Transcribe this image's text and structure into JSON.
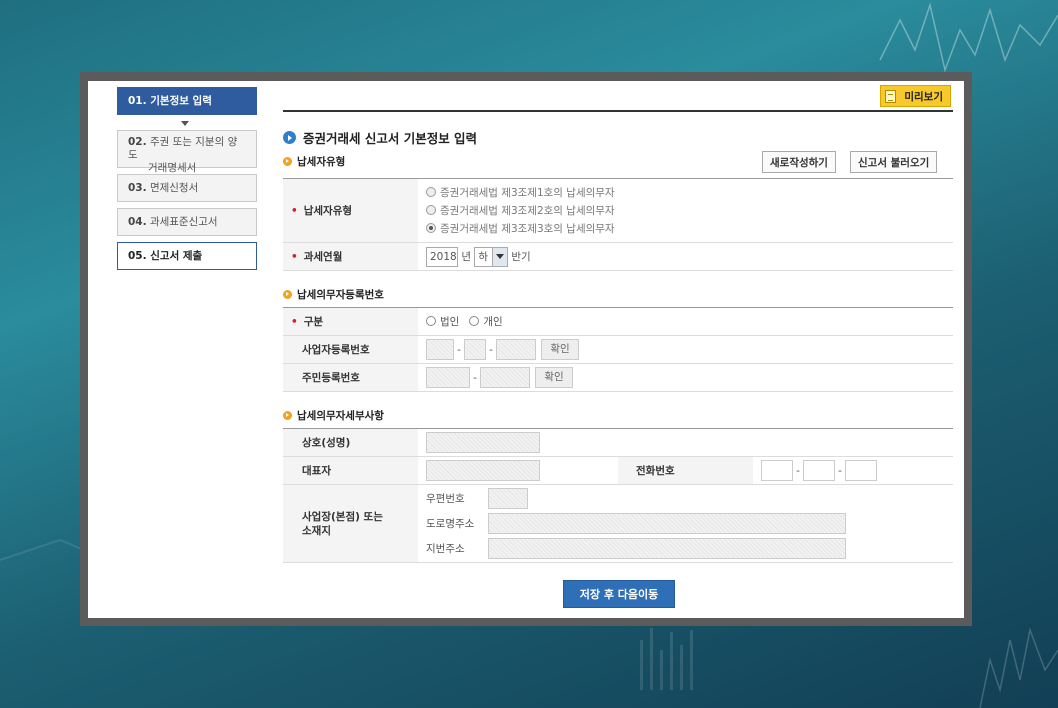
{
  "sidebar": {
    "steps": [
      {
        "num": "01.",
        "label": "기본정보 입력"
      },
      {
        "num": "02.",
        "label": "주권 또는 지분의 양도",
        "label2": "거래명세서"
      },
      {
        "num": "03.",
        "label": "면제신청서"
      },
      {
        "num": "04.",
        "label": "과세표준신고서"
      },
      {
        "num": "05.",
        "label": "신고서 제출"
      }
    ]
  },
  "header": {
    "preview_label": "미리보기",
    "page_title": "증권거래세 신고서 기본정보 입력",
    "new_button": "새로작성하기",
    "load_button": "신고서 불러오기"
  },
  "section1": {
    "title": "납세자유형",
    "row1_label": "납세자유형",
    "options": [
      "증권거래세법 제3조제1호의 납세의무자",
      "증권거래세법 제3조제2호의 납세의무자",
      "증권거래세법 제3조제3호의 납세의무자"
    ],
    "selected_option": 3,
    "row2_label": "과세연월",
    "year": "2018",
    "year_unit": "년",
    "half_value": "하",
    "half_unit": "반기"
  },
  "section2": {
    "title": "납세의무자등록번호",
    "type_label": "구분",
    "type_options": [
      "법인",
      "개인"
    ],
    "biz_label": "사업자등록번호",
    "resident_label": "주민등록번호",
    "confirm_label": "확인",
    "dash": "-"
  },
  "section3": {
    "title": "납세의무자세부사항",
    "name_label": "상호(성명)",
    "rep_label": "대표자",
    "phone_label": "전화번호",
    "addr_label": "사업장(본점) 또는",
    "addr_label2": "소재지",
    "zip_label": "우편번호",
    "road_label": "도로명주소",
    "lot_label": "지번주소"
  },
  "footer": {
    "save_label": "저장 후 다음이동"
  }
}
